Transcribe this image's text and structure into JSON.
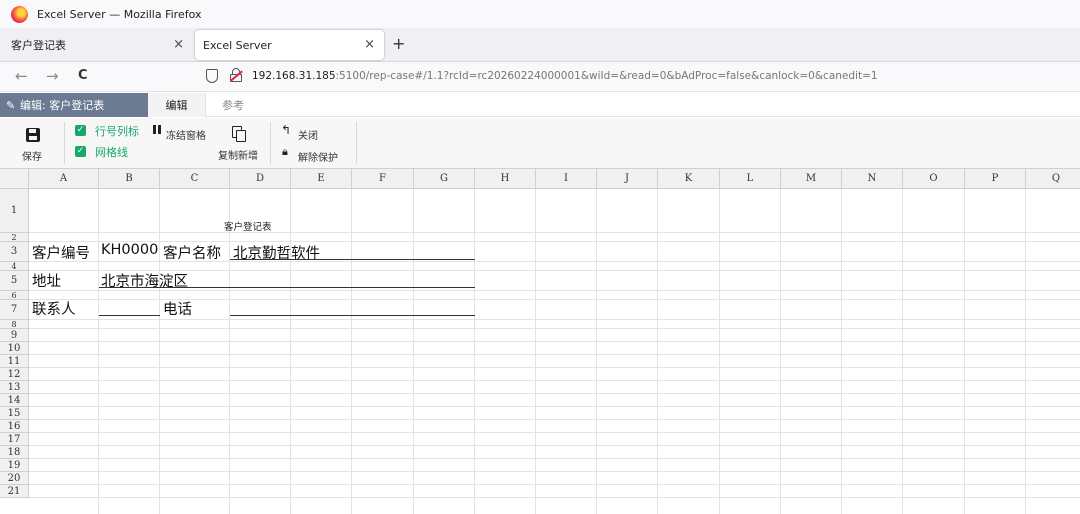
{
  "window": {
    "title": "Excel Server — Mozilla Firefox"
  },
  "browser": {
    "tabs": [
      {
        "label": "客户登记表",
        "close": "×"
      },
      {
        "label": "Excel Server",
        "close": "×"
      }
    ],
    "new_tab": "+",
    "nav": {
      "back": "←",
      "forward": "→",
      "reload": "C"
    },
    "url_host": "192.168.31.185",
    "url_rest": ":5100/rep-case#/1.1?rcId=rc20260224000001&wiId=&read=0&bAdProc=false&canlock=0&canedit=1"
  },
  "app": {
    "title_icon": "edit-icon",
    "title": "编辑: 客户登记表",
    "tabs": [
      {
        "label": "编辑"
      },
      {
        "label": "参考"
      }
    ]
  },
  "toolbar": {
    "save_label": "保存",
    "row_col_headers_label": "行号列标",
    "gridlines_label": "网格线",
    "freeze_label": "冻结窗格",
    "copy_new_label": "复制新增",
    "close_label": "关闭",
    "unprotect_label": "解除保护",
    "checked": [
      true,
      true
    ]
  },
  "sheet": {
    "columns": [
      "A",
      "B",
      "C",
      "D",
      "E",
      "F",
      "G",
      "H",
      "I",
      "J",
      "K",
      "L",
      "M",
      "N",
      "O",
      "P",
      "Q"
    ],
    "rows": [
      "1",
      "2",
      "3",
      "4",
      "5",
      "6",
      "7",
      "8",
      "9",
      "10",
      "11",
      "12",
      "13",
      "14",
      "15",
      "16",
      "17",
      "18",
      "19",
      "20",
      "21"
    ],
    "title": "客户登记表",
    "customer_no_label": "客户编号",
    "customer_no": "KH0000",
    "customer_name_label": "客户名称",
    "customer_name": "北京勤哲软件",
    "address_label": "地址",
    "address": "北京市海淀区",
    "contact_label": "联系人",
    "contact": "",
    "phone_label": "电话",
    "phone": ""
  }
}
